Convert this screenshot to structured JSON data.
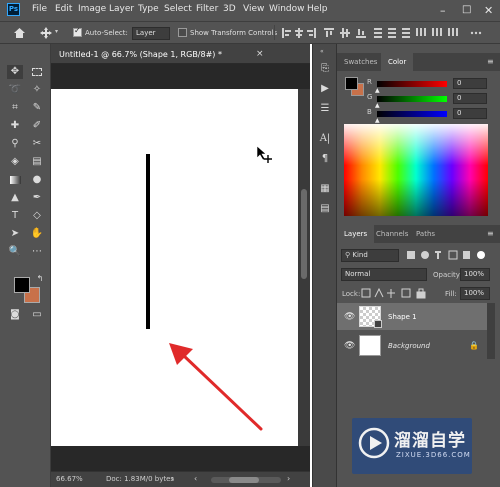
{
  "menu": {
    "items": [
      "File",
      "Edit",
      "Image",
      "Layer",
      "Type",
      "Select",
      "Filter",
      "3D",
      "View",
      "Window",
      "Help"
    ]
  },
  "options": {
    "auto_select_label": "Auto-Select:",
    "auto_select_value": "Layer",
    "transform_label": "Show Transform Controls"
  },
  "document": {
    "tab_title": "Untitled-1 @ 66.7% (Shape 1, RGB/8#) *",
    "close_glyph": "×"
  },
  "status": {
    "zoom": "66.67%",
    "doc_size": "Doc: 1.83M/0 bytes"
  },
  "panels": {
    "top_tabs": [
      "Swatches",
      "Color"
    ],
    "active_top_tab": "Color",
    "color_rows": [
      {
        "label": "R",
        "value": "0"
      },
      {
        "label": "G",
        "value": "0"
      },
      {
        "label": "B",
        "value": "0"
      }
    ],
    "layers_tabs": [
      "Layers",
      "Channels",
      "Paths"
    ],
    "active_layers_tab": "Layers",
    "filter_kind": "Kind",
    "blend_mode": "Normal",
    "opacity_label": "Opacity:",
    "opacity_value": "100%",
    "lock_label": "Lock:",
    "fill_label": "Fill:",
    "fill_value": "100%",
    "layers": [
      {
        "name": "Shape 1",
        "selected": true
      },
      {
        "name": "Background",
        "selected": false
      }
    ]
  },
  "watermark": {
    "title": "溜溜自学",
    "url": "ZIXUE.3D66.COM"
  },
  "colors": {
    "foreground": "#000000",
    "background": "#c8714a",
    "annotation_arrow": "#e02a2a",
    "panel": "#535353",
    "workspace": "#282828"
  }
}
